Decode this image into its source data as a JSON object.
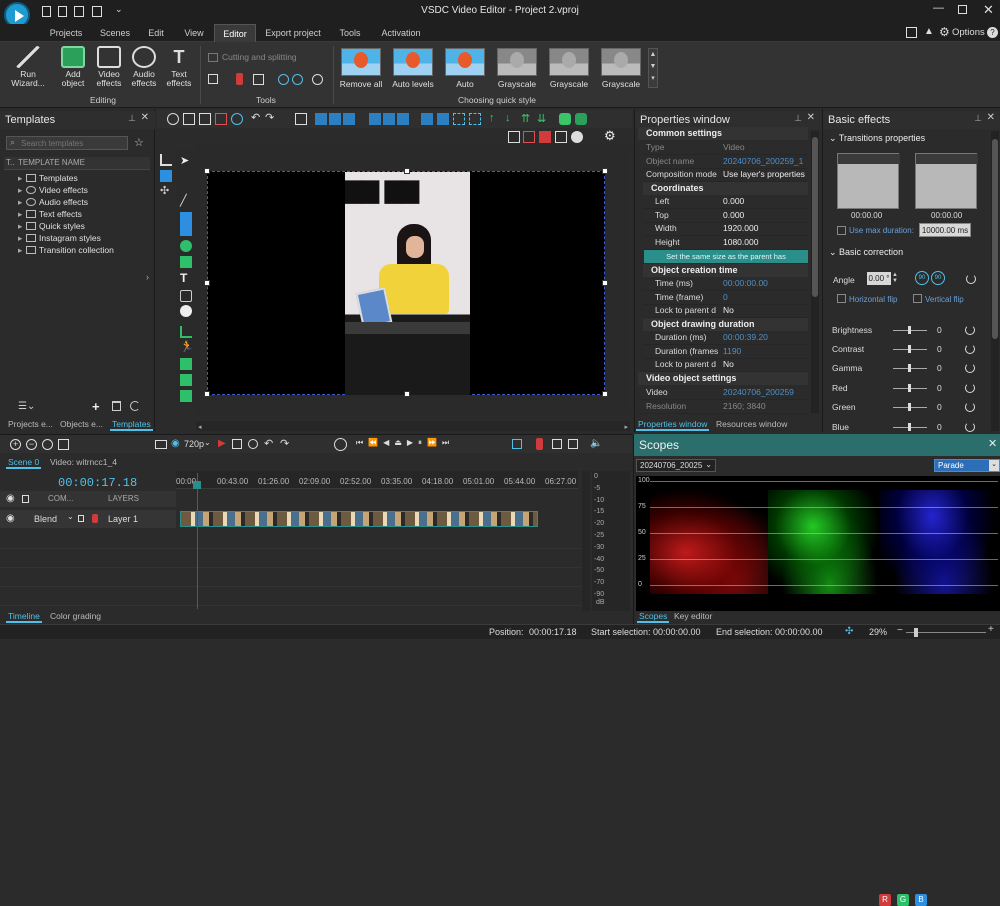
{
  "app": {
    "title": "VSDC Video Editor - Project 2.vproj",
    "options_label": "Options"
  },
  "menu": [
    "Projects",
    "Scenes",
    "Edit",
    "View",
    "Editor",
    "Export project",
    "Tools",
    "Activation"
  ],
  "ribbon": {
    "run_wizard": "Run Wizard...",
    "add_object": "Add object",
    "video_effects": "Video effects",
    "audio_effects": "Audio effects",
    "text_effects": "Text effects",
    "editing_label": "Editing",
    "cutting_splitting": "Cutting and splitting",
    "tools_label": "Tools",
    "quick_styles": [
      "Remove all",
      "Auto levels",
      "Auto",
      "Grayscale",
      "Grayscale",
      "Grayscale"
    ],
    "choosing_quick_style": "Choosing quick style"
  },
  "templates_panel": {
    "title": "Templates",
    "search_placeholder": "Search templates",
    "col_t": "T..",
    "col_name": "TEMPLATE NAME",
    "items": [
      "Templates",
      "Video effects",
      "Audio effects",
      "Text effects",
      "Quick styles",
      "Instagram styles",
      "Transition collection"
    ],
    "tabs": [
      "Projects e...",
      "Objects e...",
      "Templates"
    ]
  },
  "properties": {
    "title": "Properties window",
    "common_settings": "Common settings",
    "rows": {
      "type_k": "Type",
      "type_v": "Video",
      "objname_k": "Object name",
      "objname_v": "20240706_200259_1",
      "comp_k": "Composition mode",
      "comp_v": "Use layer's properties"
    },
    "coordinates": "Coordinates",
    "coords": {
      "left_k": "Left",
      "left_v": "0.000",
      "top_k": "Top",
      "top_v": "0.000",
      "width_k": "Width",
      "width_v": "1920.000",
      "height_k": "Height",
      "height_v": "1080.000"
    },
    "set_same_size": "Set the same size as the parent has",
    "creation_time": "Object creation time",
    "creation": {
      "ms_k": "Time (ms)",
      "ms_v": "00:00:00.00",
      "frame_k": "Time (frame)",
      "frame_v": "0",
      "lock_k": "Lock to parent d",
      "lock_v": "No"
    },
    "drawing_duration": "Object drawing duration",
    "duration": {
      "ms_k": "Duration (ms)",
      "ms_v": "00:00:39.20",
      "frames_k": "Duration (frames",
      "frames_v": "1190",
      "lock_k": "Lock to parent d",
      "lock_v": "No"
    },
    "video_settings": "Video object settings",
    "video": {
      "video_k": "Video",
      "video_v": "20240706_200259",
      "res_k": "Resolution",
      "res_v": "2160; 3840"
    },
    "tabs": [
      "Properties window",
      "Resources window"
    ]
  },
  "basic_effects": {
    "title": "Basic effects",
    "transitions": "Transitions properties",
    "t1": "00:00.00",
    "t2": "00:00.00",
    "use_max": "Use max duration:",
    "max_val": "10000.00 ms",
    "basic_correction": "Basic correction",
    "angle_label": "Angle",
    "angle_val": "0.00 °",
    "hflip": "Horizontal flip",
    "vflip": "Vertical flip",
    "sliders": [
      {
        "label": "Brightness",
        "value": "0"
      },
      {
        "label": "Contrast",
        "value": "0"
      },
      {
        "label": "Gamma",
        "value": "0"
      },
      {
        "label": "Red",
        "value": "0"
      },
      {
        "label": "Green",
        "value": "0"
      },
      {
        "label": "Blue",
        "value": "0"
      }
    ]
  },
  "timeline": {
    "resolution": "720p",
    "scene_tab": "Scene 0",
    "video_tab": "Video: witrncc1_4",
    "timecode": "00:00:17.18",
    "ruler": [
      "00:00",
      "00:43.00",
      "01:26.00",
      "02:09.00",
      "02:52.00",
      "03:35.00",
      "04:18.00",
      "05:01.00",
      "05:44.00",
      "06:27.00"
    ],
    "com_label": "COM...",
    "layers_label": "LAYERS",
    "blend_label": "Blend",
    "layer1_label": "Layer 1",
    "db_scale": [
      "0",
      "-5",
      "-10",
      "-15",
      "-20",
      "-25",
      "-30",
      "-40",
      "-50",
      "-70",
      "-90"
    ],
    "db_unit": "dB",
    "bottom_tabs": [
      "Timeline",
      "Color grading"
    ]
  },
  "scopes": {
    "title": "Scopes",
    "source": "20240706_20025",
    "mode": "Parade",
    "r": "R",
    "g": "G",
    "b": "B",
    "axis": [
      "100",
      "75",
      "50",
      "25",
      "0"
    ],
    "tabs": [
      "Scopes",
      "Key editor"
    ]
  },
  "status": {
    "position_label": "Position:",
    "position": "00:00:17.18",
    "start_label": "Start selection:",
    "start": "00:00:00.00",
    "end_label": "End selection:",
    "end": "00:00:00.00",
    "zoom": "29%"
  },
  "colors": {
    "accent": "#4fc1e9",
    "teal": "#2a8f8a",
    "playhead": "#c62828"
  }
}
